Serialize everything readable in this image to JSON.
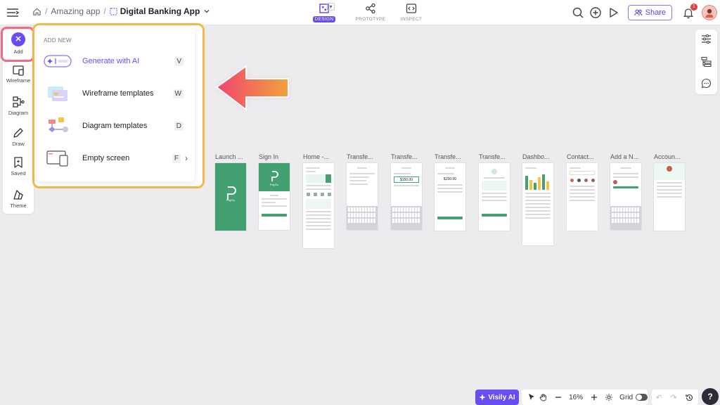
{
  "breadcrumb": {
    "parent": "Amazing app",
    "current": "Digital Banking App"
  },
  "modes": [
    {
      "label": "DESIGN",
      "active": true
    },
    {
      "label": "PROTOTYPE",
      "active": false
    },
    {
      "label": "INSPECT",
      "active": false
    }
  ],
  "share_label": "Share",
  "notifications_count": "1",
  "left_tools": [
    "Add",
    "Wireframe",
    "Diagram",
    "Draw",
    "Saved",
    "Theme"
  ],
  "add_panel": {
    "title": "ADD NEW",
    "items": [
      {
        "label": "Generate with AI",
        "key": "V"
      },
      {
        "label": "Wireframe templates",
        "key": "W"
      },
      {
        "label": "Diagram templates",
        "key": "D"
      },
      {
        "label": "Empty screen",
        "key": "F"
      }
    ]
  },
  "screens": [
    "Launch ...",
    "Sign In",
    "Home -...",
    "Transfe...",
    "Transfe...",
    "Transfe...",
    "Transfe...",
    "Dashbo...",
    "Contact...",
    "Add a N...",
    "Accoun..."
  ],
  "screen_text": {
    "app_name": "PayGo",
    "amount": "$150.00"
  },
  "bottom": {
    "ai_label": "Visily AI",
    "zoom": "16%",
    "grid_label": "Grid",
    "help": "?"
  },
  "colors": {
    "accent": "#6a4cf3",
    "brand_green": "#43a071",
    "highlight_pink": "#f06a8a",
    "highlight_orange": "#f5b74a"
  }
}
